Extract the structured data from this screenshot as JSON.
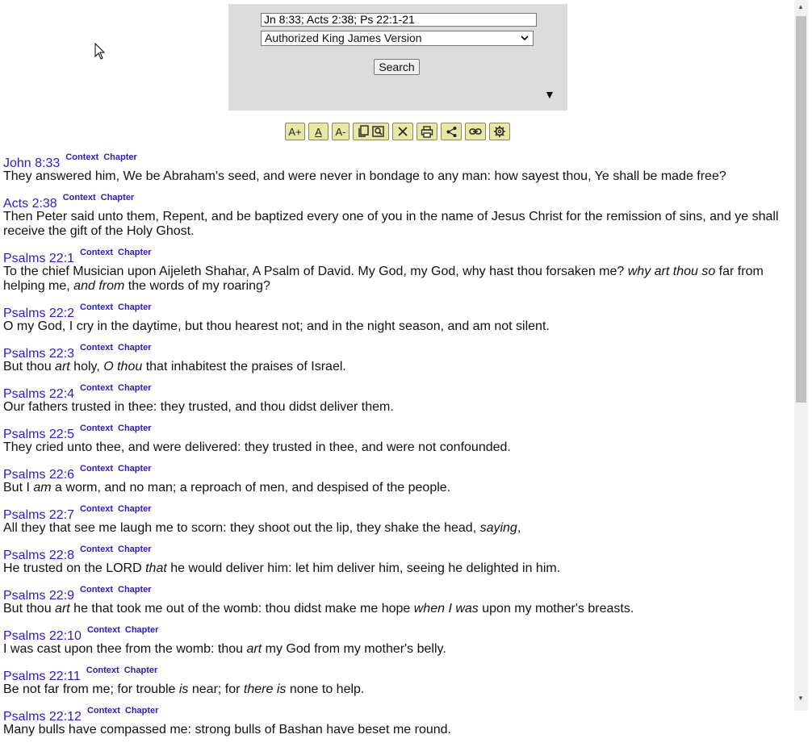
{
  "search": {
    "query": "Jn 8:33; Acts 2:38; Ps 22:1-21",
    "version": "Authorized King James Version",
    "button": "Search",
    "expand_symbol": "▼"
  },
  "toolbar": {
    "font_increase": "A+",
    "font_reset": "A",
    "font_decrease": "A-"
  },
  "links": {
    "context": "Context",
    "chapter": "Chapter"
  },
  "verses": [
    {
      "ref": "John 8:33",
      "segments": [
        {
          "t": "They answered him, We be Abraham's seed, and were never in bondage to any man: how sayest thou, Ye shall be made free?"
        }
      ]
    },
    {
      "ref": "Acts 2:38",
      "segments": [
        {
          "t": "Then Peter said unto them, Repent, and be baptized every one of you in the name of Jesus Christ for the remission of sins, and ye shall receive the gift of the Holy Ghost."
        }
      ]
    },
    {
      "ref": "Psalms 22:1",
      "segments": [
        {
          "t": "To the chief Musician upon Aijeleth Shahar, A Psalm of David. My God, my God, why hast thou forsaken me? "
        },
        {
          "t": "why art thou so",
          "i": true
        },
        {
          "t": " far from helping me, "
        },
        {
          "t": "and from",
          "i": true
        },
        {
          "t": " the words of my roaring?"
        }
      ]
    },
    {
      "ref": "Psalms 22:2",
      "segments": [
        {
          "t": "O my God, I cry in the daytime, but thou hearest not; and in the night season, and am not silent."
        }
      ]
    },
    {
      "ref": "Psalms 22:3",
      "segments": [
        {
          "t": "But thou "
        },
        {
          "t": "art",
          "i": true
        },
        {
          "t": " holy, "
        },
        {
          "t": "O thou",
          "i": true
        },
        {
          "t": " that inhabitest the praises of Israel."
        }
      ]
    },
    {
      "ref": "Psalms 22:4",
      "segments": [
        {
          "t": "Our fathers trusted in thee: they trusted, and thou didst deliver them."
        }
      ]
    },
    {
      "ref": "Psalms 22:5",
      "segments": [
        {
          "t": "They cried unto thee, and were delivered: they trusted in thee, and were not confounded."
        }
      ]
    },
    {
      "ref": "Psalms 22:6",
      "segments": [
        {
          "t": "But I "
        },
        {
          "t": "am",
          "i": true
        },
        {
          "t": " a worm, and no man; a reproach of men, and despised of the people."
        }
      ]
    },
    {
      "ref": "Psalms 22:7",
      "segments": [
        {
          "t": "All they that see me laugh me to scorn: they shoot out the lip, they shake the head, "
        },
        {
          "t": "saying",
          "i": true
        },
        {
          "t": ","
        }
      ]
    },
    {
      "ref": "Psalms 22:8",
      "segments": [
        {
          "t": "He trusted on the LORD "
        },
        {
          "t": "that",
          "i": true
        },
        {
          "t": " he would deliver him: let him deliver him, seeing he delighted in him."
        }
      ]
    },
    {
      "ref": "Psalms 22:9",
      "segments": [
        {
          "t": "But thou "
        },
        {
          "t": "art",
          "i": true
        },
        {
          "t": " he that took me out of the womb: thou didst make me hope "
        },
        {
          "t": "when I was",
          "i": true
        },
        {
          "t": " upon my mother's breasts."
        }
      ]
    },
    {
      "ref": "Psalms 22:10",
      "segments": [
        {
          "t": "I was cast upon thee from the womb: thou "
        },
        {
          "t": "art",
          "i": true
        },
        {
          "t": " my God from my mother's belly."
        }
      ]
    },
    {
      "ref": "Psalms 22:11",
      "segments": [
        {
          "t": "Be not far from me; for trouble "
        },
        {
          "t": "is",
          "i": true
        },
        {
          "t": " near; for "
        },
        {
          "t": "there is",
          "i": true
        },
        {
          "t": " none to help."
        }
      ]
    },
    {
      "ref": "Psalms 22:12",
      "segments": [
        {
          "t": "Many bulls have compassed me: strong bulls of Bashan have beset me round."
        }
      ]
    }
  ],
  "scrollbar": {
    "position": 0.0,
    "visible_fraction": 0.57
  }
}
